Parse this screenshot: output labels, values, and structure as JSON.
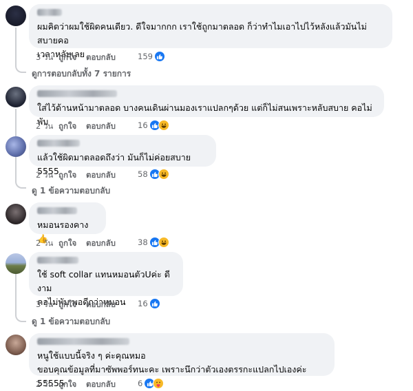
{
  "comments": [
    {
      "text": "ผมคิดว่าผมใช้ผิดคนเดียว. ดีใจมากกก เราใช้ถูกมาตลอด ก็ว่าทำไมเอาไปไว้หลังแล้วมันไม่สบายคอ\nเวลาหลับเลย",
      "time": "3 วัน",
      "like": "ถูกใจ",
      "reply": "ตอบกลับ",
      "count": "159",
      "reactions": [
        "like-icon"
      ]
    },
    {
      "text": "ใส่ไว้ด้านหน้ามาตลอด บางคนเดินผ่านมองเราแปลกๆด้วย แต่ก็ไม่สนเพราะหลับสบาย คอไม่พับ",
      "time": "2 วัน",
      "like": "ถูกใจ",
      "reply": "ตอบกลับ",
      "count": "16",
      "reactions": [
        "like-icon",
        "haha-icon"
      ]
    },
    {
      "text": "แล้วใช้ผิดมาตลอดถึงว่า มันก็ไม่ค่อยสบาย 5555",
      "time": "2 วัน",
      "like": "ถูกใจ",
      "reply": "ตอบกลับ",
      "count": "58",
      "reactions": [
        "like-icon",
        "haha-icon"
      ]
    },
    {
      "text": "หมอนรองคาง 👍",
      "time": "2 วัน",
      "like": "ถูกใจ",
      "reply": "ตอบกลับ",
      "count": "38",
      "reactions": [
        "like-icon",
        "haha-icon"
      ]
    },
    {
      "text": "ใช้ soft collar แทนหมอนตัวUค่ะ ดีงาม\nคอไม่พับ พอดีกว่าหมอน",
      "time": "3 วัน",
      "like": "ถูกใจ",
      "reply": "ตอบกลับ",
      "count": "16",
      "reactions": [
        "like-icon"
      ]
    },
    {
      "text": "หนูใช้แบบนี้จริง ๆ ค่ะคุณหมอ\nขอบคุณข้อมูลที่มาซัพพอร์ทนะคะ เพราะนึกว่าตัวเองตรรกะแปลกไปเองค่ะ 55555",
      "time": "2 วัน",
      "like": "ถูกใจ",
      "reply": "ตอบกลับ",
      "count": "6",
      "reactions": [
        "like-icon",
        "care-icon"
      ]
    }
  ],
  "view_replies": [
    "ดูการตอบกลับทั้ง 7 รายการ",
    "ดู 1 ข้อความตอบกลับ",
    "ดู 1 ข้อความตอบกลับ"
  ],
  "colors": {
    "like_blue": "#1877f2",
    "haha_yellow": "#f7b928",
    "bubble": "#f0f2f5",
    "muted": "#65676b"
  }
}
